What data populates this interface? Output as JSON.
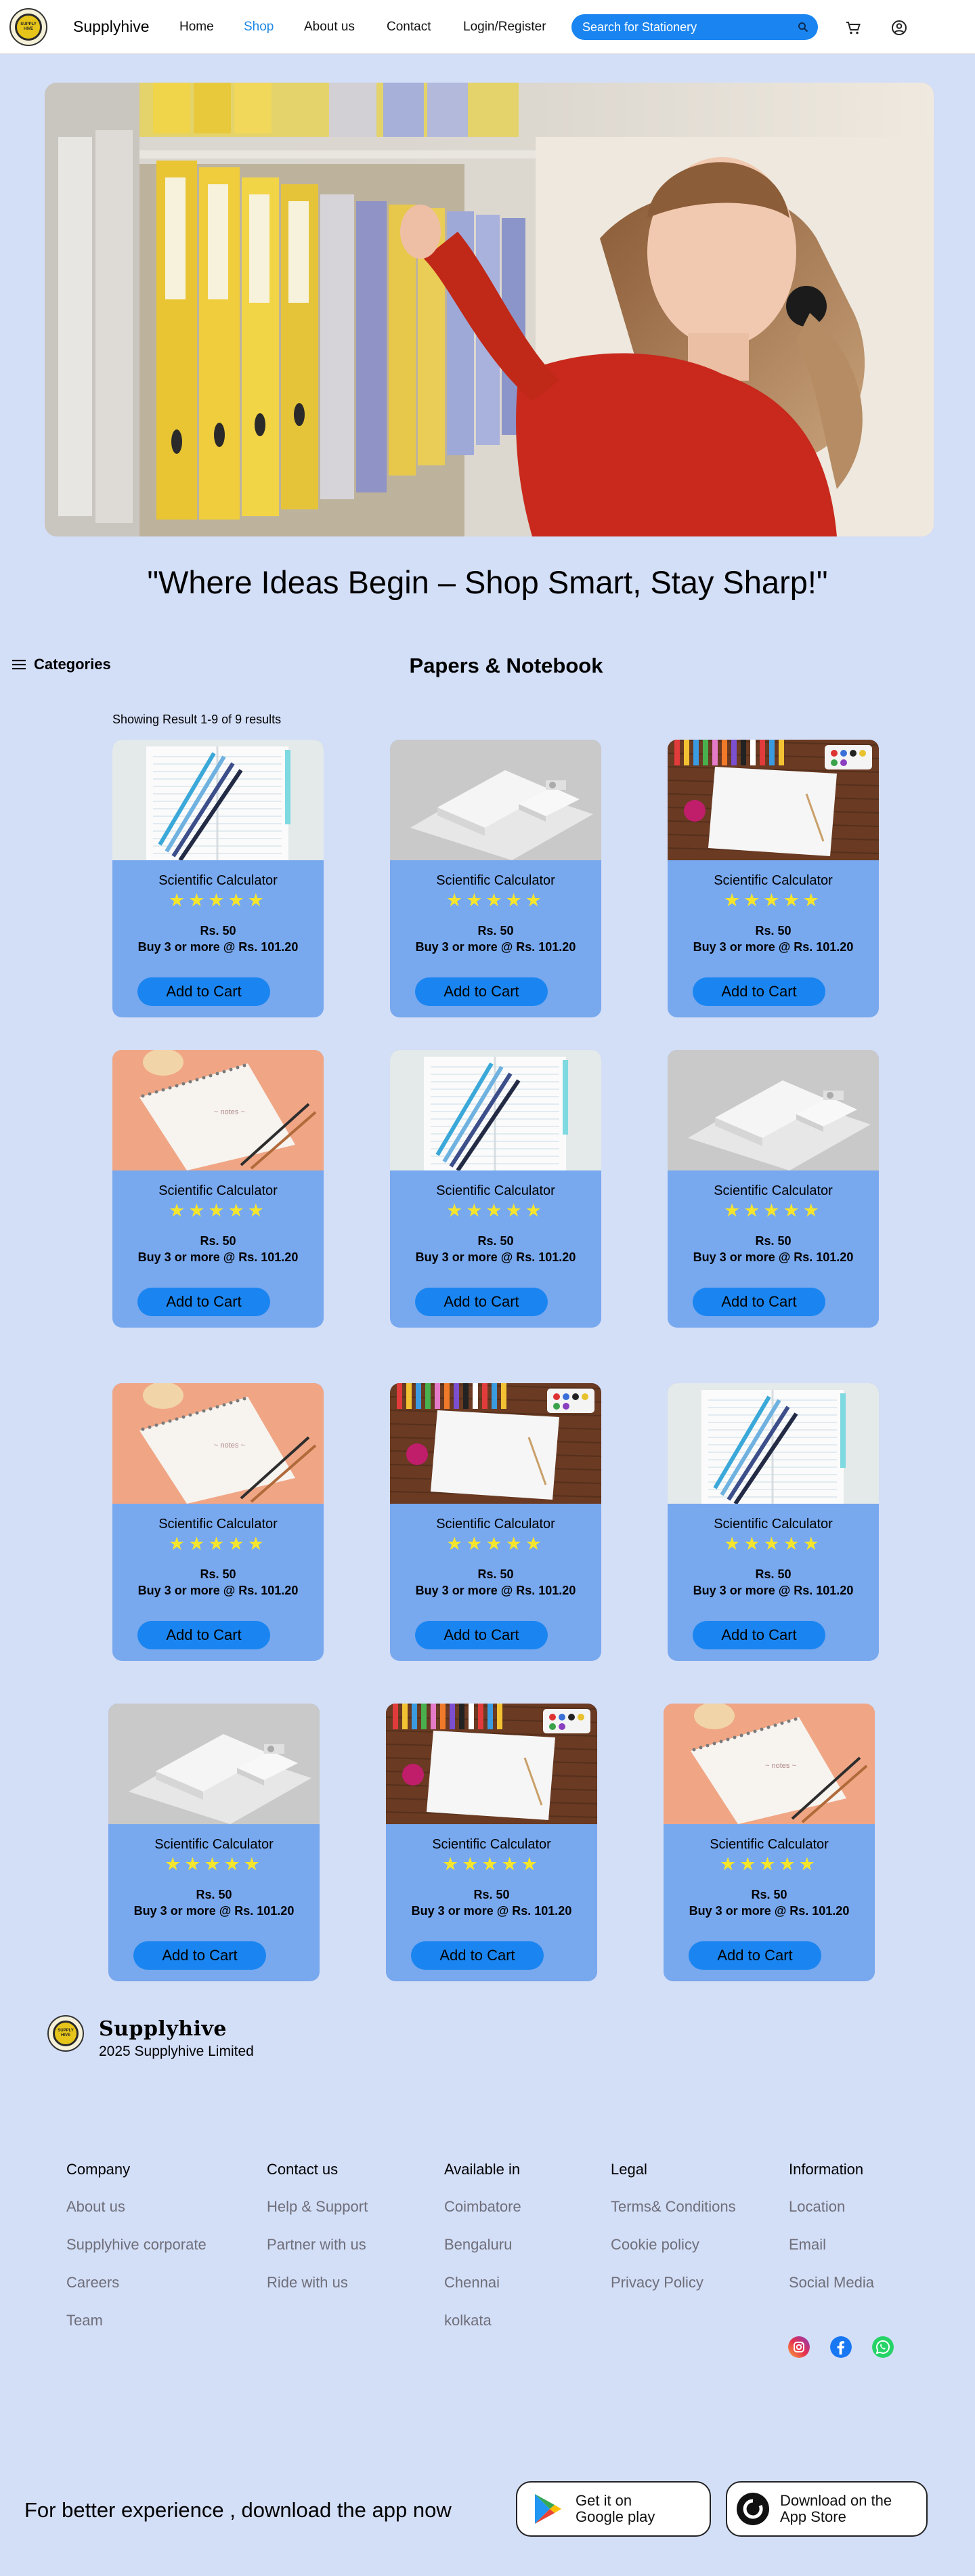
{
  "header": {
    "brand": "Supplyhive",
    "logo_text": "SUPPLY HIVE",
    "nav": [
      "Home",
      "Shop",
      "About us",
      "Contact",
      "Login/Register"
    ],
    "active_nav": "Shop",
    "search_placeholder": "Search for Stationery"
  },
  "hero": {
    "tagline": "\"Where Ideas Begin – Shop Smart, Stay Sharp!\""
  },
  "sidebar": {
    "categories_label": "Categories"
  },
  "section": {
    "title": "Papers & Notebook",
    "results_text": "Showing Result 1-9 of 9 results"
  },
  "products": [
    {
      "name": "Scientific Calculator",
      "stars": "★★★★★",
      "price": "Rs. 50",
      "bulk": "Buy 3 or more @ Rs. 101.20",
      "button": "Add to Cart",
      "image": "notebook-pens"
    },
    {
      "name": "Scientific Calculator",
      "stars": "★★★★★",
      "price": "Rs. 50",
      "bulk": "Buy 3 or more @ Rs. 101.20",
      "button": "Add to Cart",
      "image": "paper-stack"
    },
    {
      "name": "Scientific Calculator",
      "stars": "★★★★★",
      "price": "Rs. 50",
      "bulk": "Buy 3 or more @ Rs. 101.20",
      "button": "Add to Cart",
      "image": "art-paper"
    },
    {
      "name": "Scientific Calculator",
      "stars": "★★★★★",
      "price": "Rs. 50",
      "bulk": "Buy 3 or more @ Rs. 101.20",
      "button": "Add to Cart",
      "image": "spiral-notebook"
    },
    {
      "name": "Scientific Calculator",
      "stars": "★★★★★",
      "price": "Rs. 50",
      "bulk": "Buy 3 or more @ Rs. 101.20",
      "button": "Add to Cart",
      "image": "notebook-pens"
    },
    {
      "name": "Scientific Calculator",
      "stars": "★★★★★",
      "price": "Rs. 50",
      "bulk": "Buy 3 or more @ Rs. 101.20",
      "button": "Add to Cart",
      "image": "paper-stack"
    },
    {
      "name": "Scientific Calculator",
      "stars": "★★★★★",
      "price": "Rs. 50",
      "bulk": "Buy 3 or more @ Rs. 101.20",
      "button": "Add to Cart",
      "image": "spiral-notebook"
    },
    {
      "name": "Scientific Calculator",
      "stars": "★★★★★",
      "price": "Rs. 50",
      "bulk": "Buy 3 or more @ Rs. 101.20",
      "button": "Add to Cart",
      "image": "art-paper"
    },
    {
      "name": "Scientific Calculator",
      "stars": "★★★★★",
      "price": "Rs. 50",
      "bulk": "Buy 3 or more @ Rs. 101.20",
      "button": "Add to Cart",
      "image": "notebook-pens"
    },
    {
      "name": "Scientific Calculator",
      "stars": "★★★★★",
      "price": "Rs. 50",
      "bulk": "Buy 3 or more @ Rs. 101.20",
      "button": "Add to Cart",
      "image": "paper-stack"
    },
    {
      "name": "Scientific Calculator",
      "stars": "★★★★★",
      "price": "Rs. 50",
      "bulk": "Buy 3 or more @ Rs. 101.20",
      "button": "Add to Cart",
      "image": "art-paper"
    },
    {
      "name": "Scientific Calculator",
      "stars": "★★★★★",
      "price": "Rs. 50",
      "bulk": "Buy 3 or more @ Rs. 101.20",
      "button": "Add to Cart",
      "image": "spiral-notebook"
    }
  ],
  "footer": {
    "brand": "Supplyhive",
    "copyright": "2025 Supplyhive Limited",
    "columns": [
      {
        "heading": "Company",
        "links": [
          "About us",
          "Supplyhive corporate",
          "Careers",
          "Team"
        ]
      },
      {
        "heading": "Contact us",
        "links": [
          "Help & Support",
          "Partner with us",
          "Ride with us"
        ]
      },
      {
        "heading": "Available in",
        "links": [
          "Coimbatore",
          "Bengaluru",
          "Chennai",
          "kolkata"
        ]
      },
      {
        "heading": "Legal",
        "links": [
          "Terms& Conditions",
          "Cookie policy",
          "Privacy Policy"
        ]
      },
      {
        "heading": "Information",
        "links": [
          "Location",
          "Email",
          "Social Media"
        ]
      }
    ],
    "social": [
      "instagram-icon",
      "facebook-icon",
      "whatsapp-icon"
    ]
  },
  "app_banner": {
    "text": "For better experience , download the app now",
    "google_line1": "Get it on",
    "google_line2": "Google play",
    "apple_line1": "Download on the",
    "apple_line2": "App Store"
  },
  "colors": {
    "page_bg": "#d3def7",
    "card_bg": "#78a8ee",
    "accent_blue": "#1a85f0",
    "star": "#f5e52c",
    "footer_link": "#6f6f7a"
  }
}
